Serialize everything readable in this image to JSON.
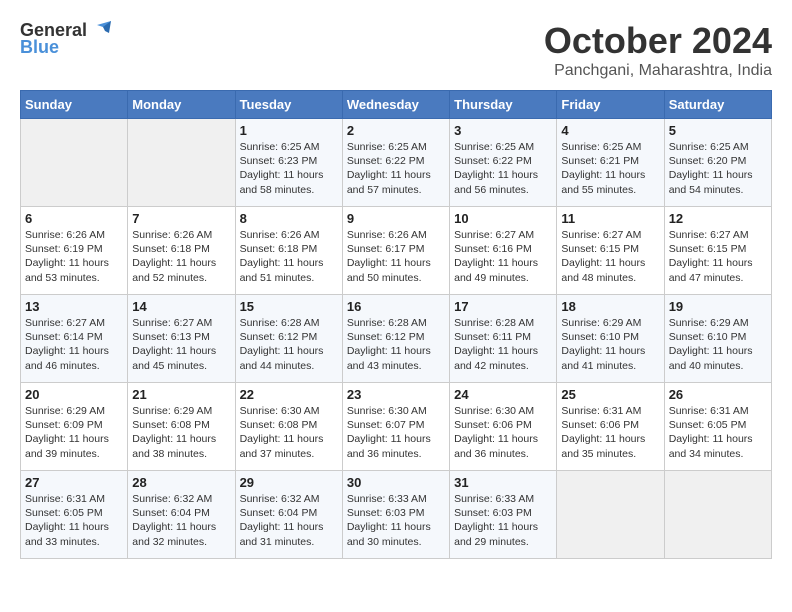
{
  "logo": {
    "line1": "General",
    "line2": "Blue"
  },
  "title": "October 2024",
  "subtitle": "Panchgani, Maharashtra, India",
  "headers": [
    "Sunday",
    "Monday",
    "Tuesday",
    "Wednesday",
    "Thursday",
    "Friday",
    "Saturday"
  ],
  "weeks": [
    [
      {
        "day": "",
        "sunrise": "",
        "sunset": "",
        "daylight": ""
      },
      {
        "day": "",
        "sunrise": "",
        "sunset": "",
        "daylight": ""
      },
      {
        "day": "1",
        "sunrise": "Sunrise: 6:25 AM",
        "sunset": "Sunset: 6:23 PM",
        "daylight": "Daylight: 11 hours and 58 minutes."
      },
      {
        "day": "2",
        "sunrise": "Sunrise: 6:25 AM",
        "sunset": "Sunset: 6:22 PM",
        "daylight": "Daylight: 11 hours and 57 minutes."
      },
      {
        "day": "3",
        "sunrise": "Sunrise: 6:25 AM",
        "sunset": "Sunset: 6:22 PM",
        "daylight": "Daylight: 11 hours and 56 minutes."
      },
      {
        "day": "4",
        "sunrise": "Sunrise: 6:25 AM",
        "sunset": "Sunset: 6:21 PM",
        "daylight": "Daylight: 11 hours and 55 minutes."
      },
      {
        "day": "5",
        "sunrise": "Sunrise: 6:25 AM",
        "sunset": "Sunset: 6:20 PM",
        "daylight": "Daylight: 11 hours and 54 minutes."
      }
    ],
    [
      {
        "day": "6",
        "sunrise": "Sunrise: 6:26 AM",
        "sunset": "Sunset: 6:19 PM",
        "daylight": "Daylight: 11 hours and 53 minutes."
      },
      {
        "day": "7",
        "sunrise": "Sunrise: 6:26 AM",
        "sunset": "Sunset: 6:18 PM",
        "daylight": "Daylight: 11 hours and 52 minutes."
      },
      {
        "day": "8",
        "sunrise": "Sunrise: 6:26 AM",
        "sunset": "Sunset: 6:18 PM",
        "daylight": "Daylight: 11 hours and 51 minutes."
      },
      {
        "day": "9",
        "sunrise": "Sunrise: 6:26 AM",
        "sunset": "Sunset: 6:17 PM",
        "daylight": "Daylight: 11 hours and 50 minutes."
      },
      {
        "day": "10",
        "sunrise": "Sunrise: 6:27 AM",
        "sunset": "Sunset: 6:16 PM",
        "daylight": "Daylight: 11 hours and 49 minutes."
      },
      {
        "day": "11",
        "sunrise": "Sunrise: 6:27 AM",
        "sunset": "Sunset: 6:15 PM",
        "daylight": "Daylight: 11 hours and 48 minutes."
      },
      {
        "day": "12",
        "sunrise": "Sunrise: 6:27 AM",
        "sunset": "Sunset: 6:15 PM",
        "daylight": "Daylight: 11 hours and 47 minutes."
      }
    ],
    [
      {
        "day": "13",
        "sunrise": "Sunrise: 6:27 AM",
        "sunset": "Sunset: 6:14 PM",
        "daylight": "Daylight: 11 hours and 46 minutes."
      },
      {
        "day": "14",
        "sunrise": "Sunrise: 6:27 AM",
        "sunset": "Sunset: 6:13 PM",
        "daylight": "Daylight: 11 hours and 45 minutes."
      },
      {
        "day": "15",
        "sunrise": "Sunrise: 6:28 AM",
        "sunset": "Sunset: 6:12 PM",
        "daylight": "Daylight: 11 hours and 44 minutes."
      },
      {
        "day": "16",
        "sunrise": "Sunrise: 6:28 AM",
        "sunset": "Sunset: 6:12 PM",
        "daylight": "Daylight: 11 hours and 43 minutes."
      },
      {
        "day": "17",
        "sunrise": "Sunrise: 6:28 AM",
        "sunset": "Sunset: 6:11 PM",
        "daylight": "Daylight: 11 hours and 42 minutes."
      },
      {
        "day": "18",
        "sunrise": "Sunrise: 6:29 AM",
        "sunset": "Sunset: 6:10 PM",
        "daylight": "Daylight: 11 hours and 41 minutes."
      },
      {
        "day": "19",
        "sunrise": "Sunrise: 6:29 AM",
        "sunset": "Sunset: 6:10 PM",
        "daylight": "Daylight: 11 hours and 40 minutes."
      }
    ],
    [
      {
        "day": "20",
        "sunrise": "Sunrise: 6:29 AM",
        "sunset": "Sunset: 6:09 PM",
        "daylight": "Daylight: 11 hours and 39 minutes."
      },
      {
        "day": "21",
        "sunrise": "Sunrise: 6:29 AM",
        "sunset": "Sunset: 6:08 PM",
        "daylight": "Daylight: 11 hours and 38 minutes."
      },
      {
        "day": "22",
        "sunrise": "Sunrise: 6:30 AM",
        "sunset": "Sunset: 6:08 PM",
        "daylight": "Daylight: 11 hours and 37 minutes."
      },
      {
        "day": "23",
        "sunrise": "Sunrise: 6:30 AM",
        "sunset": "Sunset: 6:07 PM",
        "daylight": "Daylight: 11 hours and 36 minutes."
      },
      {
        "day": "24",
        "sunrise": "Sunrise: 6:30 AM",
        "sunset": "Sunset: 6:06 PM",
        "daylight": "Daylight: 11 hours and 36 minutes."
      },
      {
        "day": "25",
        "sunrise": "Sunrise: 6:31 AM",
        "sunset": "Sunset: 6:06 PM",
        "daylight": "Daylight: 11 hours and 35 minutes."
      },
      {
        "day": "26",
        "sunrise": "Sunrise: 6:31 AM",
        "sunset": "Sunset: 6:05 PM",
        "daylight": "Daylight: 11 hours and 34 minutes."
      }
    ],
    [
      {
        "day": "27",
        "sunrise": "Sunrise: 6:31 AM",
        "sunset": "Sunset: 6:05 PM",
        "daylight": "Daylight: 11 hours and 33 minutes."
      },
      {
        "day": "28",
        "sunrise": "Sunrise: 6:32 AM",
        "sunset": "Sunset: 6:04 PM",
        "daylight": "Daylight: 11 hours and 32 minutes."
      },
      {
        "day": "29",
        "sunrise": "Sunrise: 6:32 AM",
        "sunset": "Sunset: 6:04 PM",
        "daylight": "Daylight: 11 hours and 31 minutes."
      },
      {
        "day": "30",
        "sunrise": "Sunrise: 6:33 AM",
        "sunset": "Sunset: 6:03 PM",
        "daylight": "Daylight: 11 hours and 30 minutes."
      },
      {
        "day": "31",
        "sunrise": "Sunrise: 6:33 AM",
        "sunset": "Sunset: 6:03 PM",
        "daylight": "Daylight: 11 hours and 29 minutes."
      },
      {
        "day": "",
        "sunrise": "",
        "sunset": "",
        "daylight": ""
      },
      {
        "day": "",
        "sunrise": "",
        "sunset": "",
        "daylight": ""
      }
    ]
  ]
}
